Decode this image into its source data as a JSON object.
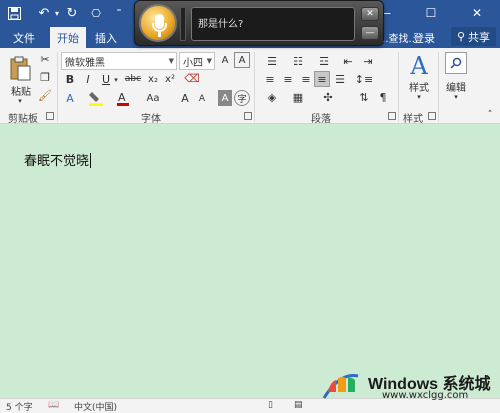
{
  "app": {
    "brand_color": "#2b579a",
    "document_bg": "#cdebd3"
  },
  "quick_access": {
    "save_icon": "save-icon",
    "undo_icon": "undo-icon",
    "redo_icon": "redo-icon",
    "touch_icon": "touch-mode-icon",
    "customize_icon": "customize-qa-icon"
  },
  "window": {
    "minimize": "—",
    "restore": "☐",
    "close": "✕"
  },
  "tabs": [
    {
      "label": "文件",
      "active": false
    },
    {
      "label": "开始",
      "active": true
    },
    {
      "label": "插入",
      "active": false
    },
    {
      "label": "...查找...",
      "active": false
    },
    {
      "label": "登录",
      "active": false
    }
  ],
  "share_label": "共享",
  "ribbon": {
    "clipboard": {
      "paste_label": "粘贴",
      "group_label": "剪贴板"
    },
    "font": {
      "font_name": "微软雅黑",
      "font_size": "小四",
      "bold": "B",
      "italic": "I",
      "underline": "U",
      "strike": "abc",
      "subscript": "x₂",
      "superscript": "x²",
      "group_label": "字体"
    },
    "paragraph": {
      "group_label": "段落"
    },
    "styles": {
      "label": "样式",
      "group_label": "样式"
    },
    "editing": {
      "label": "编辑"
    }
  },
  "voice": {
    "prompt": "那是什么?",
    "close": "✕",
    "minimize": "—"
  },
  "document": {
    "text": "春眠不觉晓"
  },
  "status": {
    "word_count": "5 个字",
    "language": "中文(中国)"
  },
  "watermark": {
    "title": "Windows 系统城",
    "url": "www.wxclgg.com"
  }
}
